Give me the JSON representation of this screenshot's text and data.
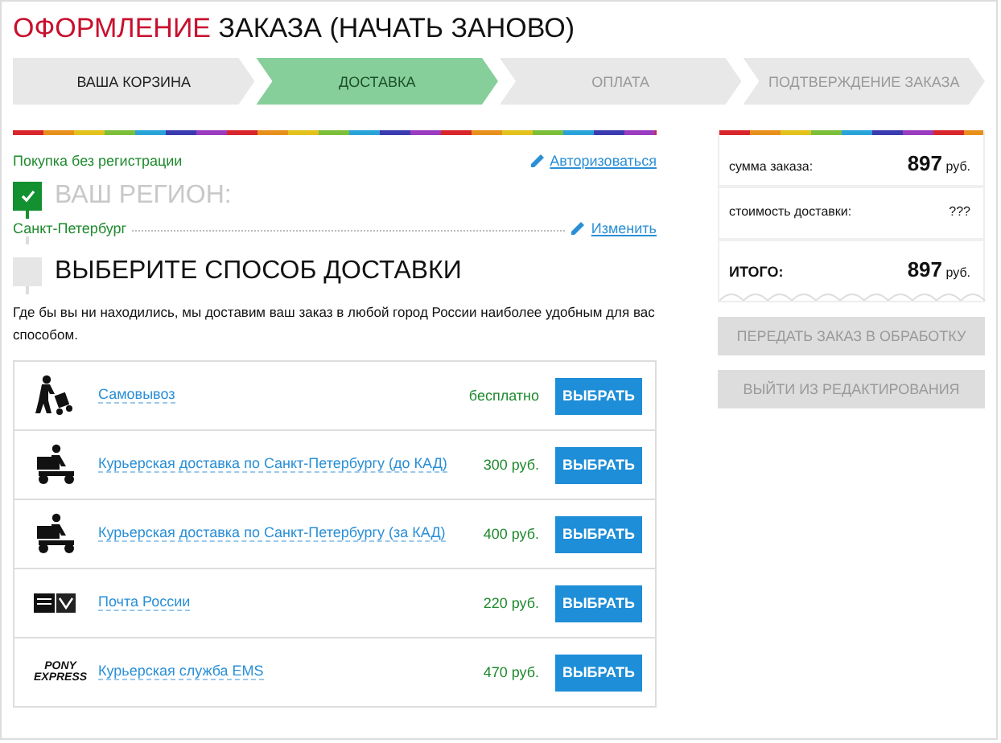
{
  "header": {
    "title_accent": "ОФОРМЛЕНИЕ",
    "title_rest": "ЗАКАЗА (НАЧАТЬ ЗАНОВО)"
  },
  "steps": [
    {
      "label": "ВАША КОРЗИНА",
      "selected": false,
      "disabled": false
    },
    {
      "label": "ДОСТАВКА",
      "selected": true,
      "disabled": false
    },
    {
      "label": "ОПЛАТА",
      "selected": false,
      "disabled": true
    },
    {
      "label": "ПОДТВЕРЖДЕНИЕ ЗАКАЗА",
      "selected": false,
      "disabled": true
    }
  ],
  "guest_note": "Покупка без регистрации",
  "login_link": "Авторизоваться",
  "region": {
    "title": "ВАШ РЕГИОН:",
    "completed": true,
    "value": "Санкт-Петербург",
    "change_link": "Изменить"
  },
  "delivery": {
    "title": "ВЫБЕРИТЕ СПОСОБ ДОСТАВКИ",
    "completed": false,
    "description": "Где бы вы ни находились, мы доставим ваш заказ в любой город России наиболее удобным для вас способом.",
    "options": [
      {
        "kind": "pickup",
        "name": "Самовывоз",
        "price": "бесплатно",
        "button": "ВЫБРАТЬ"
      },
      {
        "kind": "courier",
        "name": "Курьерская доставка по Санкт-Петербургу (до КАД)",
        "price": "300 руб.",
        "button": "ВЫБРАТЬ"
      },
      {
        "kind": "courier",
        "name": "Курьерская доставка по Санкт-Петербургу (за КАД)",
        "price": "400 руб.",
        "button": "ВЫБРАТЬ"
      },
      {
        "kind": "post",
        "name": "Почта России",
        "price": "220 руб.",
        "button": "ВЫБРАТЬ"
      },
      {
        "kind": "logo",
        "logo_lines": [
          "PONY",
          "EXPRESS"
        ],
        "name": "Курьерская служба EMS",
        "price": "470 руб.",
        "button": "ВЫБРАТЬ"
      }
    ]
  },
  "summary": {
    "rows": [
      {
        "label": "сумма заказа:",
        "amount": "897",
        "unit": "руб.",
        "total": false
      },
      {
        "label": "стоимость доставки:",
        "amount": "???",
        "total": false
      },
      {
        "label": "ИТОГО:",
        "amount": "897",
        "unit": "руб.",
        "total": true
      }
    ],
    "buttons": [
      {
        "label": "ПЕРЕДАТЬ ЗАКАЗ В ОБРАБОТКУ",
        "disabled": true
      },
      {
        "label": "ВЫЙТИ ИЗ РЕДАКТИРОВАНИЯ",
        "disabled": true
      }
    ]
  }
}
